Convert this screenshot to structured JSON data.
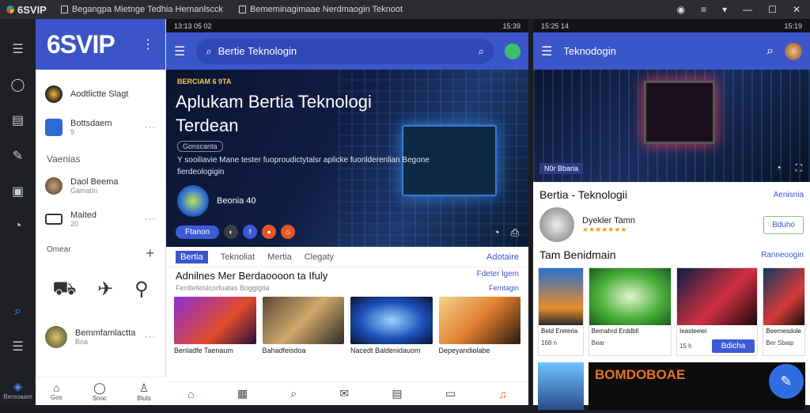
{
  "window": {
    "app_name": "6SVIP",
    "tabs": [
      "Begangpa Mietnge Tedhia Hernanlscck",
      "Bememinagimaae Nerdmaogin Teknoot"
    ]
  },
  "rail": {
    "bottom_label": "Bersoaam"
  },
  "panel1": {
    "brand": "6SVIP",
    "rows": [
      {
        "label": "Aodtlictte Slagt",
        "sub": ""
      },
      {
        "label": "Bottsdaem",
        "sub": "9"
      }
    ],
    "section_title": "Vaenias",
    "contacts": [
      {
        "label": "Daol Beema",
        "sub": "Gamatin"
      },
      {
        "label": "Maited",
        "sub": "20"
      }
    ],
    "section2_title": "Omear",
    "bottom_contact": {
      "label": "Bemmfamlactta",
      "sub": "Boa"
    },
    "tabs": [
      "Gos",
      "Snoc",
      "Bluts"
    ]
  },
  "panel2": {
    "status_time": "13:13 05 02",
    "status_right": "15:39",
    "search_text": "Bertie Teknologin",
    "hero": {
      "tag": "BERCIAM 6 9TA",
      "title": "Aplukam Bertia Teknologi Terdean",
      "chip": "Gonscanta",
      "desc": "Y sooiliavie Mane tester fuoproudictytalsr aplicke fuonlderenlian Begone fierdeologigin",
      "author_name": "Beonia 40",
      "read_button": "Ftanon"
    },
    "tabs": [
      "Bertia",
      "Teknoliat",
      "Mertia",
      "Clegaty"
    ],
    "tabs_link": "Adotaire",
    "headline": "Adnilnes Mer Berdaoooon ta Ifuly",
    "headline_link": "Fdeter lgem",
    "meta_left": "Ferdlefelslcorfuatas Boggigtia",
    "meta_link": "Ferntagin",
    "thumbs": [
      {
        "caption": "Benladfe Taenaum"
      },
      {
        "caption": "Bahadfeisdoa"
      },
      {
        "caption": "Nacedt Baldenidauom"
      },
      {
        "caption": "Depeyandiolabe"
      }
    ]
  },
  "panel3": {
    "status_time": "15:25 14",
    "status_right": "15:19",
    "title": "Teknodogin",
    "hero_tag": "N0r Bbaria",
    "section_title": "Bertia - Teknologii",
    "section_link": "Aenisnia",
    "profile_name": "Dyekler Tamn",
    "profile_stars": "★★★★★★★",
    "follow_label": "Bduho",
    "row_title": "Tam Benidmain",
    "row_link": "Ranneoogin",
    "cards": [
      {
        "caption": "Beld Ereteria",
        "foot": "168 n"
      },
      {
        "caption": "Bemahrd Erddbll",
        "foot": "Bear"
      },
      {
        "caption": "Ieasteeiei",
        "foot": "15 h",
        "button": "Bdicha"
      },
      {
        "caption": "Beemesdole",
        "foot": "Ber Sbaip"
      }
    ],
    "promo": "BOMDOBOAE"
  }
}
